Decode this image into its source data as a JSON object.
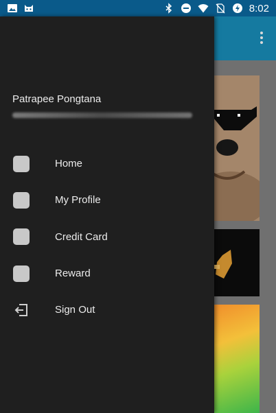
{
  "status_bar": {
    "time": "8:02",
    "left_icons": [
      "image-icon",
      "cat-face-icon"
    ],
    "right_icons": [
      "bluetooth-icon",
      "do-not-disturb-icon",
      "wifi-icon",
      "no-sim-icon",
      "battery-charging-icon"
    ]
  },
  "drawer": {
    "user_name": "Patrapee Pongtana",
    "menu": [
      {
        "label": "Home",
        "icon": "home-icon"
      },
      {
        "label": "My Profile",
        "icon": "profile-icon"
      },
      {
        "label": "Credit Card",
        "icon": "credit-card-icon"
      },
      {
        "label": "Reward",
        "icon": "reward-icon"
      },
      {
        "label": "Sign Out",
        "icon": "sign-out-icon"
      }
    ]
  },
  "colors": {
    "status_bar": "#0a5a8a",
    "toolbar": "#157aa0",
    "drawer_background": "#1f1f1f",
    "text": "#ececec"
  }
}
